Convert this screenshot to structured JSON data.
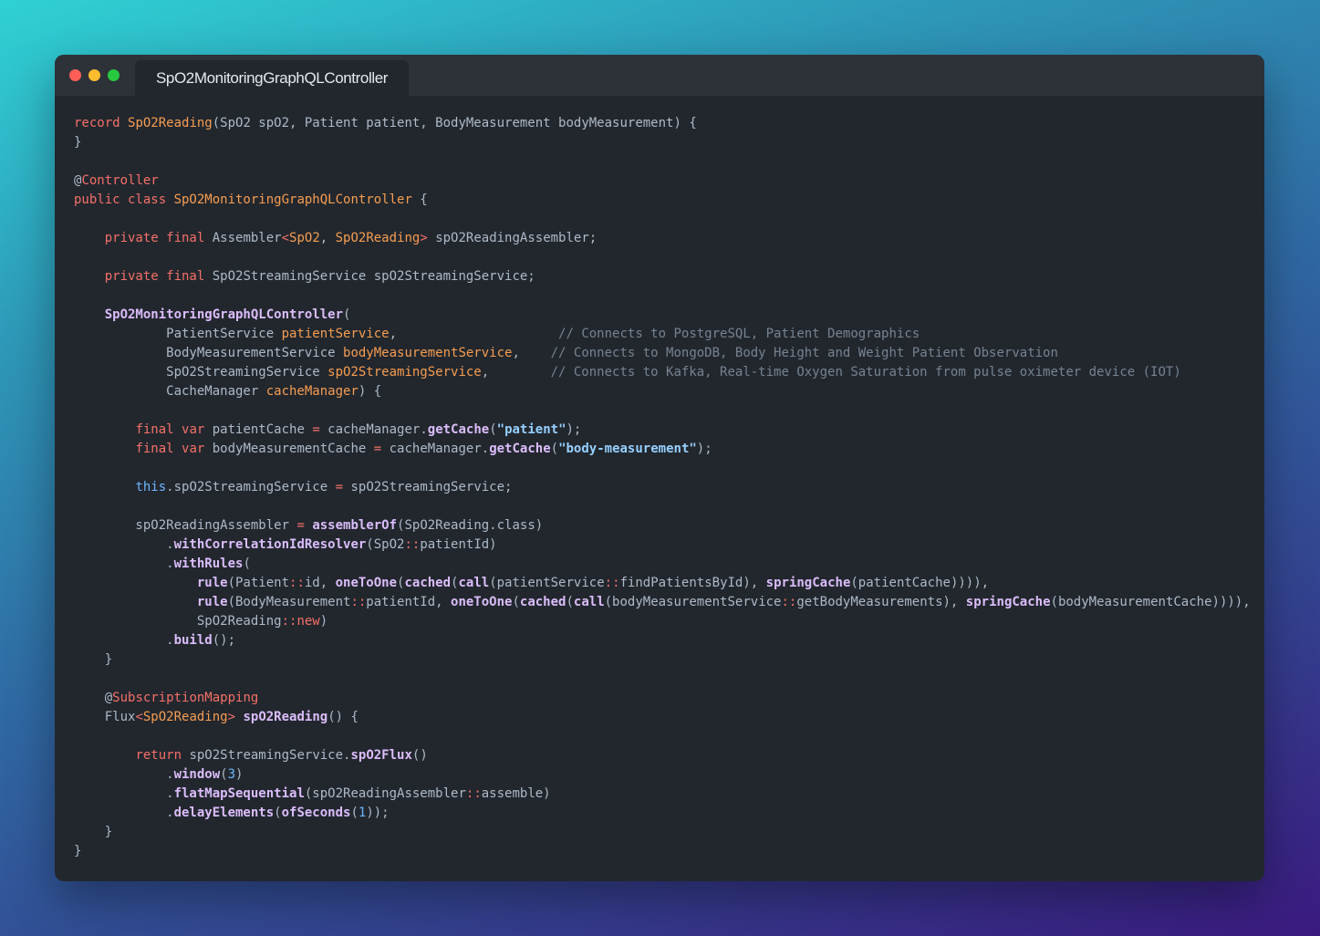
{
  "window": {
    "tab_title": "SpO2MonitoringGraphQLController",
    "colors": {
      "close": "#ff5f57",
      "minimize": "#febc2e",
      "maximize": "#28c840",
      "background": "#22272e"
    }
  },
  "code_lines": [
    [
      [
        "kw",
        "record "
      ],
      [
        "type",
        "SpO2Reading"
      ],
      [
        "plain",
        "(SpO2 spO2, Patient patient, BodyMeasurement bodyMeasurement) {"
      ]
    ],
    [
      [
        "plain",
        "}"
      ]
    ],
    [],
    [
      [
        "plain",
        "@"
      ],
      [
        "kw",
        "Controller"
      ]
    ],
    [
      [
        "kw",
        "public class "
      ],
      [
        "type",
        "SpO2MonitoringGraphQLController"
      ],
      [
        "plain",
        " {"
      ]
    ],
    [],
    [
      [
        "plain",
        "    "
      ],
      [
        "kw",
        "private final "
      ],
      [
        "plain",
        "Assembler"
      ],
      [
        "op",
        "<"
      ],
      [
        "type",
        "SpO2"
      ],
      [
        "plain",
        ", "
      ],
      [
        "type",
        "SpO2Reading"
      ],
      [
        "op",
        ">"
      ],
      [
        "plain",
        " spO2ReadingAssembler;"
      ]
    ],
    [],
    [
      [
        "plain",
        "    "
      ],
      [
        "kw",
        "private final "
      ],
      [
        "plain",
        "SpO2StreamingService spO2StreamingService;"
      ]
    ],
    [],
    [
      [
        "plain",
        "    "
      ],
      [
        "fn",
        "SpO2MonitoringGraphQLController"
      ],
      [
        "plain",
        "("
      ]
    ],
    [
      [
        "plain",
        "            PatientService "
      ],
      [
        "type",
        "patientService"
      ],
      [
        "plain",
        ",                     "
      ],
      [
        "com",
        "// Connects to PostgreSQL, Patient Demographics"
      ]
    ],
    [
      [
        "plain",
        "            BodyMeasurementService "
      ],
      [
        "type",
        "bodyMeasurementService"
      ],
      [
        "plain",
        ",    "
      ],
      [
        "com",
        "// Connects to MongoDB, Body Height and Weight Patient Observation"
      ]
    ],
    [
      [
        "plain",
        "            SpO2StreamingService "
      ],
      [
        "type",
        "spO2StreamingService"
      ],
      [
        "plain",
        ",        "
      ],
      [
        "com",
        "// Connects to Kafka, Real-time Oxygen Saturation from pulse oximeter device (IOT)"
      ]
    ],
    [
      [
        "plain",
        "            CacheManager "
      ],
      [
        "type",
        "cacheManager"
      ],
      [
        "plain",
        ") {"
      ]
    ],
    [],
    [
      [
        "plain",
        "        "
      ],
      [
        "kw",
        "final var "
      ],
      [
        "plain",
        "patientCache "
      ],
      [
        "op",
        "="
      ],
      [
        "plain",
        " cacheManager."
      ],
      [
        "fn",
        "getCache"
      ],
      [
        "plain",
        "("
      ],
      [
        "str",
        "\"patient\""
      ],
      [
        "plain",
        ");"
      ]
    ],
    [
      [
        "plain",
        "        "
      ],
      [
        "kw",
        "final var "
      ],
      [
        "plain",
        "bodyMeasurementCache "
      ],
      [
        "op",
        "="
      ],
      [
        "plain",
        " cacheManager."
      ],
      [
        "fn",
        "getCache"
      ],
      [
        "plain",
        "("
      ],
      [
        "str",
        "\"body-measurement\""
      ],
      [
        "plain",
        ");"
      ]
    ],
    [],
    [
      [
        "plain",
        "        "
      ],
      [
        "this",
        "this"
      ],
      [
        "plain",
        ".spO2StreamingService "
      ],
      [
        "op",
        "="
      ],
      [
        "plain",
        " spO2StreamingService;"
      ]
    ],
    [],
    [
      [
        "plain",
        "        spO2ReadingAssembler "
      ],
      [
        "op",
        "="
      ],
      [
        "plain",
        " "
      ],
      [
        "fn",
        "assemblerOf"
      ],
      [
        "plain",
        "(SpO2Reading.class)"
      ]
    ],
    [
      [
        "plain",
        "            ."
      ],
      [
        "fn",
        "withCorrelationIdResolver"
      ],
      [
        "plain",
        "(SpO2"
      ],
      [
        "op",
        "::"
      ],
      [
        "plain",
        "patientId)"
      ]
    ],
    [
      [
        "plain",
        "            ."
      ],
      [
        "fn",
        "withRules"
      ],
      [
        "plain",
        "("
      ]
    ],
    [
      [
        "plain",
        "                "
      ],
      [
        "fn",
        "rule"
      ],
      [
        "plain",
        "(Patient"
      ],
      [
        "op",
        "::"
      ],
      [
        "plain",
        "id, "
      ],
      [
        "fn",
        "oneToOne"
      ],
      [
        "plain",
        "("
      ],
      [
        "fn",
        "cached"
      ],
      [
        "plain",
        "("
      ],
      [
        "fn",
        "call"
      ],
      [
        "plain",
        "(patientService"
      ],
      [
        "op",
        "::"
      ],
      [
        "plain",
        "findPatientsById), "
      ],
      [
        "fn",
        "springCache"
      ],
      [
        "plain",
        "(patientCache)))),"
      ]
    ],
    [
      [
        "plain",
        "                "
      ],
      [
        "fn",
        "rule"
      ],
      [
        "plain",
        "(BodyMeasurement"
      ],
      [
        "op",
        "::"
      ],
      [
        "plain",
        "patientId, "
      ],
      [
        "fn",
        "oneToOne"
      ],
      [
        "plain",
        "("
      ],
      [
        "fn",
        "cached"
      ],
      [
        "plain",
        "("
      ],
      [
        "fn",
        "call"
      ],
      [
        "plain",
        "(bodyMeasurementService"
      ],
      [
        "op",
        "::"
      ],
      [
        "plain",
        "getBodyMeasurements), "
      ],
      [
        "fn",
        "springCache"
      ],
      [
        "plain",
        "(bodyMeasurementCache)))),"
      ]
    ],
    [
      [
        "plain",
        "                SpO2Reading"
      ],
      [
        "op",
        "::"
      ],
      [
        "kw",
        "new"
      ],
      [
        "plain",
        ")"
      ]
    ],
    [
      [
        "plain",
        "            ."
      ],
      [
        "fn",
        "build"
      ],
      [
        "plain",
        "();"
      ]
    ],
    [
      [
        "plain",
        "    }"
      ]
    ],
    [],
    [
      [
        "plain",
        "    @"
      ],
      [
        "kw",
        "SubscriptionMapping"
      ]
    ],
    [
      [
        "plain",
        "    Flux"
      ],
      [
        "op",
        "<"
      ],
      [
        "type",
        "SpO2Reading"
      ],
      [
        "op",
        ">"
      ],
      [
        "plain",
        " "
      ],
      [
        "fn",
        "spO2Reading"
      ],
      [
        "plain",
        "() {"
      ]
    ],
    [],
    [
      [
        "plain",
        "        "
      ],
      [
        "kw",
        "return "
      ],
      [
        "plain",
        "spO2StreamingService."
      ],
      [
        "fn",
        "spO2Flux"
      ],
      [
        "plain",
        "()"
      ]
    ],
    [
      [
        "plain",
        "            ."
      ],
      [
        "fn",
        "window"
      ],
      [
        "plain",
        "("
      ],
      [
        "num",
        "3"
      ],
      [
        "plain",
        ")"
      ]
    ],
    [
      [
        "plain",
        "            ."
      ],
      [
        "fn",
        "flatMapSequential"
      ],
      [
        "plain",
        "(spO2ReadingAssembler"
      ],
      [
        "op",
        "::"
      ],
      [
        "plain",
        "assemble)"
      ]
    ],
    [
      [
        "plain",
        "            ."
      ],
      [
        "fn",
        "delayElements"
      ],
      [
        "plain",
        "("
      ],
      [
        "fn",
        "ofSeconds"
      ],
      [
        "plain",
        "("
      ],
      [
        "num",
        "1"
      ],
      [
        "plain",
        "));"
      ]
    ],
    [
      [
        "plain",
        "    }"
      ]
    ],
    [
      [
        "plain",
        "}"
      ]
    ]
  ]
}
